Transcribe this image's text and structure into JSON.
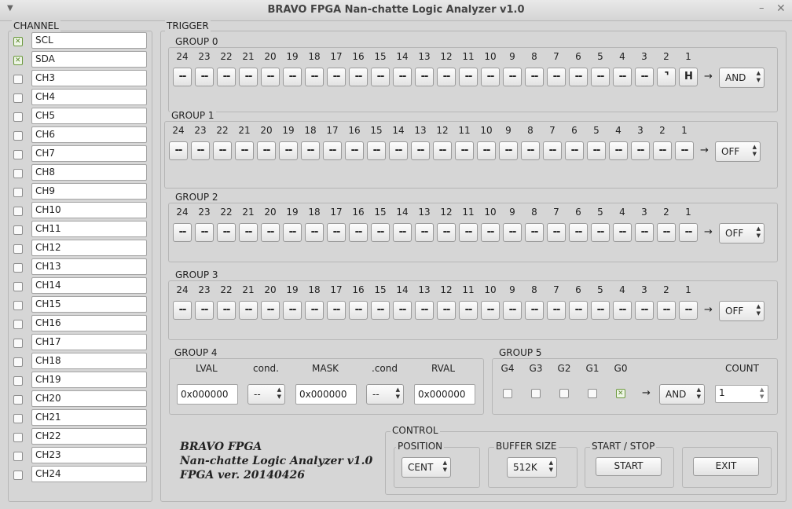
{
  "window": {
    "title": "BRAVO FPGA Nan-chatte Logic Analyzer v1.0"
  },
  "channel": {
    "title": "CHANNEL",
    "items": [
      {
        "label": "SCL",
        "checked": true
      },
      {
        "label": "SDA",
        "checked": true
      },
      {
        "label": "CH3",
        "checked": false
      },
      {
        "label": "CH4",
        "checked": false
      },
      {
        "label": "CH5",
        "checked": false
      },
      {
        "label": "CH6",
        "checked": false
      },
      {
        "label": "CH7",
        "checked": false
      },
      {
        "label": "CH8",
        "checked": false
      },
      {
        "label": "CH9",
        "checked": false
      },
      {
        "label": "CH10",
        "checked": false
      },
      {
        "label": "CH11",
        "checked": false
      },
      {
        "label": "CH12",
        "checked": false
      },
      {
        "label": "CH13",
        "checked": false
      },
      {
        "label": "CH14",
        "checked": false
      },
      {
        "label": "CH15",
        "checked": false
      },
      {
        "label": "CH16",
        "checked": false
      },
      {
        "label": "CH17",
        "checked": false
      },
      {
        "label": "CH18",
        "checked": false
      },
      {
        "label": "CH19",
        "checked": false
      },
      {
        "label": "CH20",
        "checked": false
      },
      {
        "label": "CH21",
        "checked": false
      },
      {
        "label": "CH22",
        "checked": false
      },
      {
        "label": "CH23",
        "checked": false
      },
      {
        "label": "CH24",
        "checked": false
      }
    ]
  },
  "trigger": {
    "title": "TRIGGER",
    "bit_labels": [
      "24",
      "23",
      "22",
      "21",
      "20",
      "19",
      "18",
      "17",
      "16",
      "15",
      "14",
      "13",
      "12",
      "11",
      "10",
      "9",
      "8",
      "7",
      "6",
      "5",
      "4",
      "3",
      "2",
      "1"
    ],
    "arrow": "→",
    "groups": [
      {
        "name": "GROUP 0",
        "op": "AND",
        "bits": [
          "--",
          "--",
          "--",
          "--",
          "--",
          "--",
          "--",
          "--",
          "--",
          "--",
          "--",
          "--",
          "--",
          "--",
          "--",
          "--",
          "--",
          "--",
          "--",
          "--",
          "--",
          "--",
          "⌝",
          "H"
        ]
      },
      {
        "name": "GROUP 1",
        "op": "OFF",
        "bits": [
          "--",
          "--",
          "--",
          "--",
          "--",
          "--",
          "--",
          "--",
          "--",
          "--",
          "--",
          "--",
          "--",
          "--",
          "--",
          "--",
          "--",
          "--",
          "--",
          "--",
          "--",
          "--",
          "--",
          "--"
        ]
      },
      {
        "name": "GROUP 2",
        "op": "OFF",
        "bits": [
          "--",
          "--",
          "--",
          "--",
          "--",
          "--",
          "--",
          "--",
          "--",
          "--",
          "--",
          "--",
          "--",
          "--",
          "--",
          "--",
          "--",
          "--",
          "--",
          "--",
          "--",
          "--",
          "--",
          "--"
        ]
      },
      {
        "name": "GROUP 3",
        "op": "OFF",
        "bits": [
          "--",
          "--",
          "--",
          "--",
          "--",
          "--",
          "--",
          "--",
          "--",
          "--",
          "--",
          "--",
          "--",
          "--",
          "--",
          "--",
          "--",
          "--",
          "--",
          "--",
          "--",
          "--",
          "--",
          "--"
        ]
      }
    ],
    "group4": {
      "name": "GROUP 4",
      "lval_label": "LVAL",
      "lval": "0x000000",
      "cond_label": "cond.",
      "cond": "--",
      "mask_label": "MASK",
      "mask": "0x000000",
      "cond2_label": ".cond",
      "cond2": "--",
      "rval_label": "RVAL",
      "rval": "0x000000"
    },
    "group5": {
      "name": "GROUP 5",
      "items": [
        {
          "label": "G4",
          "checked": false
        },
        {
          "label": "G3",
          "checked": false
        },
        {
          "label": "G2",
          "checked": false
        },
        {
          "label": "G1",
          "checked": false
        },
        {
          "label": "G0",
          "checked": true
        }
      ],
      "op": "AND",
      "count_label": "COUNT",
      "count": "1"
    }
  },
  "info": {
    "line1": "BRAVO FPGA",
    "line2": "Nan-chatte Logic Analyzer v1.0",
    "line3": "FPGA ver. 20140426"
  },
  "control": {
    "title": "CONTROL",
    "position_label": "POSITION",
    "position": "CENT",
    "buffer_label": "BUFFER SIZE",
    "buffer": "512K",
    "startstop_label": "START / STOP",
    "start_button": "START",
    "exit_button": "EXIT"
  }
}
